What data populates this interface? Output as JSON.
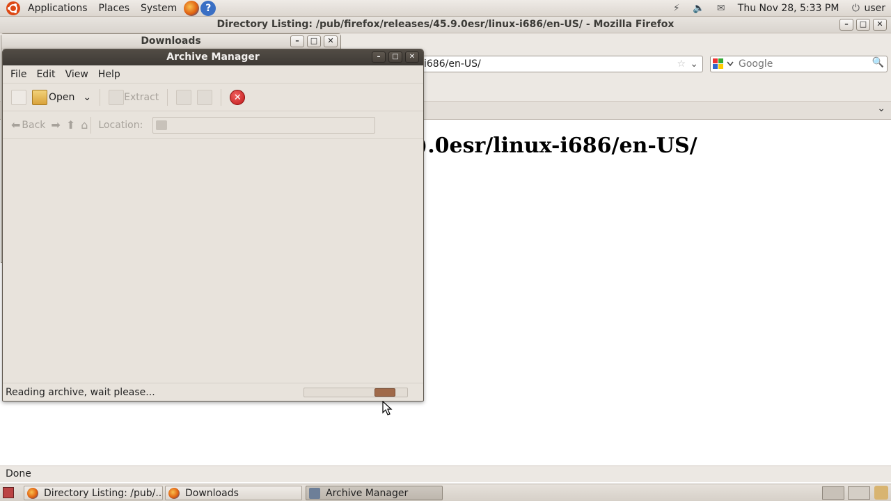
{
  "top_panel": {
    "menus": [
      "Applications",
      "Places",
      "System"
    ],
    "clock": "Thu Nov 28,  5:33 PM",
    "user": "user"
  },
  "firefox": {
    "title": "Directory Listing: /pub/firefox/releases/45.9.0esr/linux-i686/en-US/ - Mozilla Firefox",
    "url_visible": "i686/en-US/",
    "search_placeholder": "Google",
    "heading_visible": ").0esr/linux-i686/en-US/",
    "status": "Done"
  },
  "downloads_window": {
    "title": "Downloads"
  },
  "archive_manager": {
    "title": "Archive Manager",
    "menu": [
      "File",
      "Edit",
      "View",
      "Help"
    ],
    "toolbar": {
      "open_label": "Open",
      "extract_label": "Extract"
    },
    "location_bar": {
      "back_label": "Back",
      "location_label": "Location:",
      "location_value": ""
    },
    "status_text": "Reading archive, wait please...",
    "progress_fraction": 0.86
  },
  "taskbar": {
    "tasks": [
      {
        "label": "Directory Listing: /pub/...",
        "active": false
      },
      {
        "label": "Downloads",
        "active": false
      },
      {
        "label": "Archive Manager",
        "active": true
      }
    ]
  }
}
